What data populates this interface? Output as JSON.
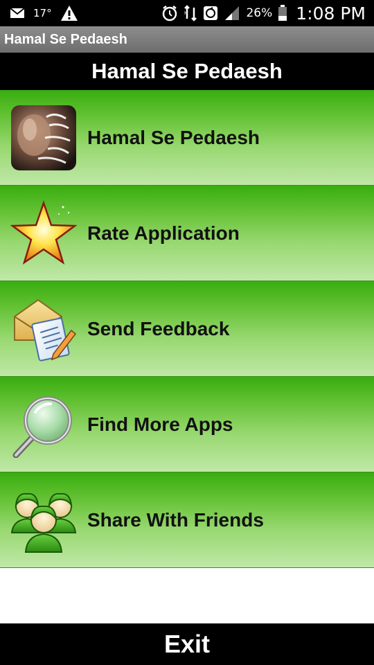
{
  "status_bar": {
    "temperature": "17°",
    "battery_percent": "26%",
    "time": "1:08 PM",
    "icons": [
      "email-icon",
      "warning-icon",
      "alarm-icon",
      "data-transfer-icon",
      "sync-icon",
      "signal-icon",
      "battery-icon"
    ]
  },
  "action_bar": {
    "title": "Hamal Se Pedaesh"
  },
  "header": {
    "title": "Hamal Se Pedaesh"
  },
  "menu": {
    "items": [
      {
        "label": "Hamal Se Pedaesh",
        "icon": "app-logo-icon"
      },
      {
        "label": "Rate Application",
        "icon": "star-icon"
      },
      {
        "label": "Send Feedback",
        "icon": "feedback-icon"
      },
      {
        "label": "Find More Apps",
        "icon": "magnifier-icon"
      },
      {
        "label": "Share With Friends",
        "icon": "people-icon"
      }
    ]
  },
  "exit": {
    "label": "Exit"
  },
  "colors": {
    "menu_gradient_top": "#38ad10",
    "menu_gradient_bottom": "#c0e8a8",
    "bar_background": "#000000"
  }
}
